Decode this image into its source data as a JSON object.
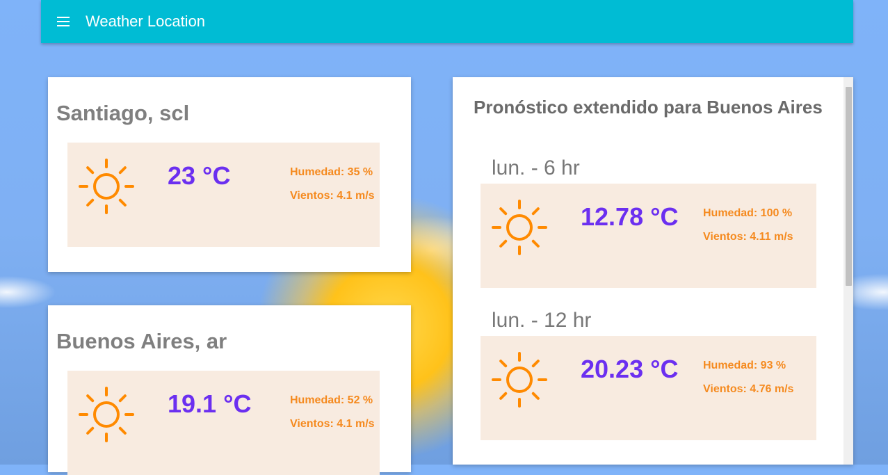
{
  "app": {
    "title": "Weather Location",
    "menu_icon": "menu-icon"
  },
  "cities": [
    {
      "name": "Santiago, scl",
      "icon": "sun-icon",
      "temperature": "23 °C",
      "humidity": "Humedad: 35 %",
      "wind": "Vientos: 4.1 m/s"
    },
    {
      "name": "Buenos Aires, ar",
      "icon": "sun-icon",
      "temperature": "19.1 °C",
      "humidity": "Humedad: 52 %",
      "wind": "Vientos: 4.1 m/s"
    }
  ],
  "forecast": {
    "title": "Pronóstico extendido para Buenos Aires",
    "items": [
      {
        "label": "lun. - 6 hr",
        "icon": "sun-icon",
        "temperature": "12.78 °C",
        "humidity": "Humedad: 100 %",
        "wind": "Vientos: 4.11 m/s"
      },
      {
        "label": "lun. - 12 hr",
        "icon": "sun-icon",
        "temperature": "20.23 °C",
        "humidity": "Humedad: 93 %",
        "wind": "Vientos: 4.76 m/s"
      }
    ]
  },
  "colors": {
    "appbar": "#00bcd4",
    "temperature": "#6b2ff0",
    "info": "#f58a1f",
    "sun": "#ff8a00",
    "weather_box": "#f8ebe0"
  }
}
